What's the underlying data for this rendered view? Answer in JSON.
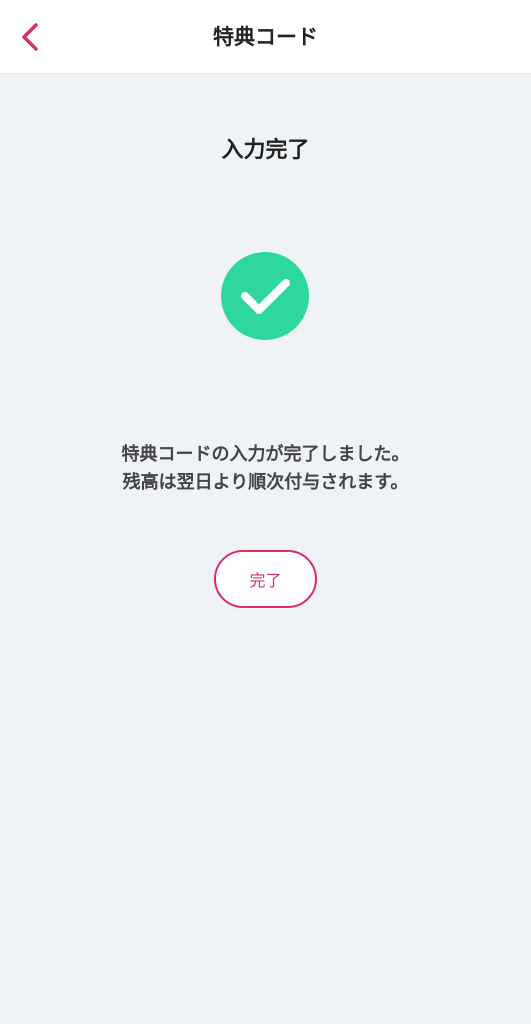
{
  "header": {
    "title": "特典コード",
    "back_icon": "chevron-left-icon",
    "accent_color": "#d62f6a"
  },
  "main": {
    "title": "入力完了",
    "status_icon": "check-circle-icon",
    "status_color": "#2ed89c",
    "message_lines": [
      "特典コードの入力が完了しました。",
      "残高は翌日より順次付与されます。"
    ],
    "done_label": "完了"
  }
}
